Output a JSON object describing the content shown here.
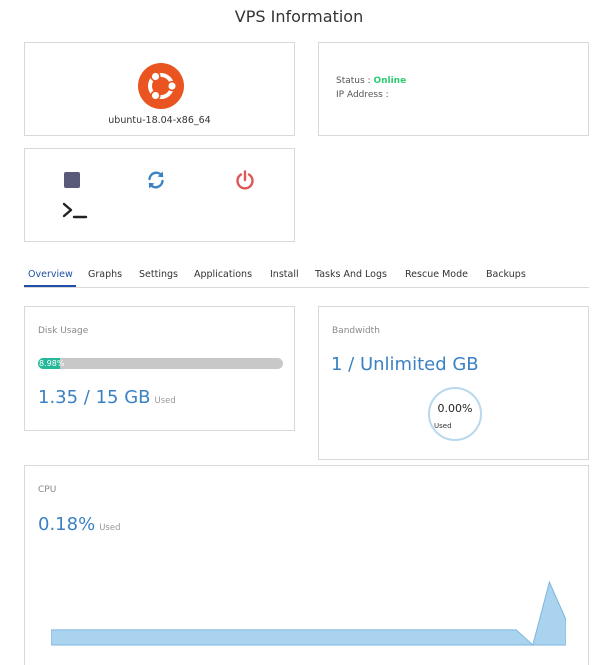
{
  "page": {
    "title": "VPS Information"
  },
  "os": {
    "name": "ubuntu-18.04-x86_64",
    "logo_icon": "ubuntu-logo-icon",
    "logo_color": "#e95420"
  },
  "status": {
    "status_label": "Status :",
    "status_value": "Online",
    "status_color": "#2ecc71",
    "ip_label": "IP Address :",
    "ip_value": ""
  },
  "actions": [
    {
      "icon": "stop-icon",
      "color": "#5a5a7a"
    },
    {
      "icon": "restart-icon",
      "color": "#3b82c4"
    },
    {
      "icon": "power-icon",
      "color": "#e05555"
    },
    {
      "icon": "console-icon",
      "color": "#222222"
    }
  ],
  "tabs": [
    {
      "label": "Overview",
      "active": true
    },
    {
      "label": "Graphs"
    },
    {
      "label": "Settings"
    },
    {
      "label": "Applications"
    },
    {
      "label": "Install"
    },
    {
      "label": "Tasks And Logs"
    },
    {
      "label": "Rescue Mode"
    },
    {
      "label": "Backups"
    }
  ],
  "disk": {
    "label": "Disk Usage",
    "percent_text": "8.98%",
    "percent": 8.98,
    "used_value": "1.35 / 15 GB",
    "used_label": "Used"
  },
  "bandwidth": {
    "label": "Bandwidth",
    "value": "1 / Unlimited GB",
    "percent_text": "0.00%",
    "used_label": "Used"
  },
  "cpu": {
    "label": "CPU",
    "value": "0.18%",
    "used_label": "Used",
    "fill_color": "#a9d3ef",
    "stroke_color": "#7fb6df",
    "samples": [
      0.18,
      0.18,
      0.18,
      0.18,
      0.18,
      0.18,
      0.18,
      0.18,
      0.18,
      0.18,
      0.18,
      0.18,
      0.18,
      0.18,
      0.18,
      0.18,
      0.18,
      0.18,
      0.18,
      0.18,
      0.18,
      0.18,
      0.18,
      0.18,
      0.18,
      0.18,
      0.18,
      0.18,
      0.18,
      0.0,
      0.75,
      0.3
    ],
    "max": 1.0
  }
}
